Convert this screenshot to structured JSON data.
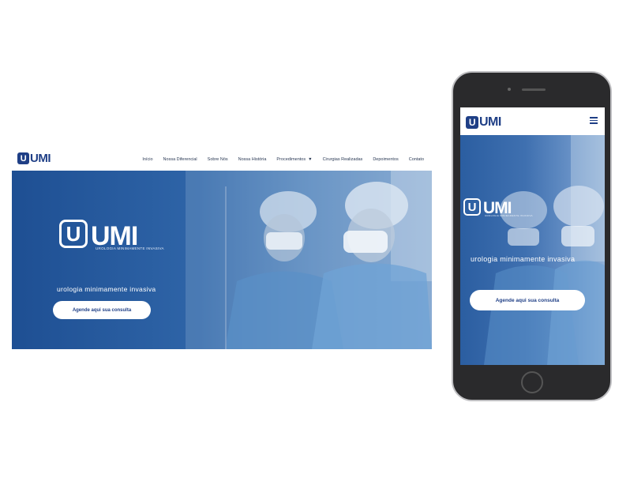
{
  "brand": {
    "logo_letter": "U",
    "logo_text": "UMI",
    "logo_subtitle": "UROLOGIA MINIMAMENTE INVASIVA"
  },
  "nav": {
    "items": [
      "Início",
      "Nossa Diferencial",
      "Sobre Nós",
      "Nossa História",
      "Procedimentos",
      "Cirurgias Realizadas",
      "Depoimentos",
      "Contato"
    ]
  },
  "hero": {
    "tagline": "urologia minimamente invasiva",
    "cta": "Agende aqui sua consulta"
  },
  "colors": {
    "brand_blue": "#1f3f86",
    "hero_blue": "#2f65a8",
    "phone_body": "#2a2a2c"
  },
  "icons": {
    "caret": "caret-down-icon",
    "menu": "hamburger-icon"
  }
}
